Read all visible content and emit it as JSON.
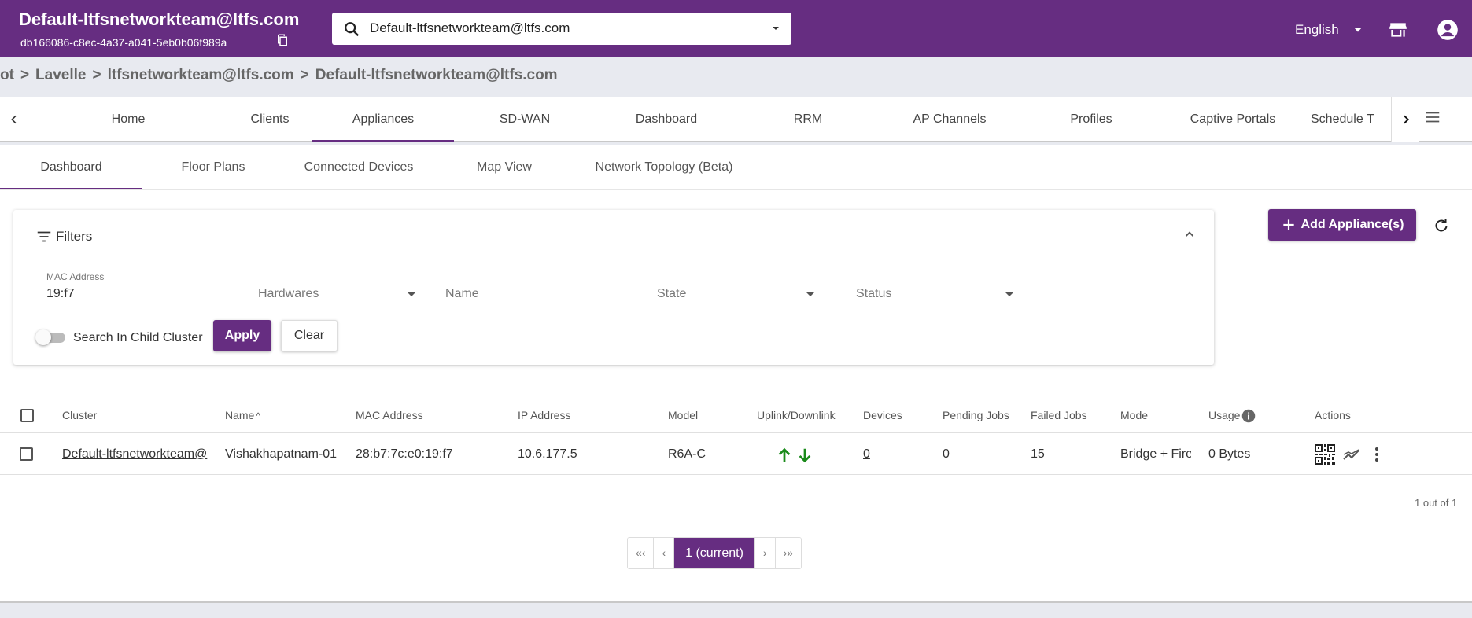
{
  "header": {
    "org_title": "Default-ltfsnetworkteam@ltfs.com",
    "org_id": "db166086-c8ec-4a37-a041-5eb0b06f989a",
    "search_value": "Default-ltfsnetworkteam@ltfs.com",
    "language": "English"
  },
  "breadcrumb": [
    "ot",
    "Lavelle",
    "ltfsnetworkteam@ltfs.com",
    "Default-ltfsnetworkteam@ltfs.com"
  ],
  "nav": {
    "tabs": [
      "Home",
      "Clients",
      "Appliances",
      "SD-WAN",
      "Dashboard",
      "RRM",
      "AP Channels",
      "Profiles",
      "Captive Portals",
      "Schedule T"
    ],
    "active": "Appliances"
  },
  "subtabs": [
    "Dashboard",
    "Floor Plans",
    "Connected Devices",
    "Map View",
    "Network Topology (Beta)"
  ],
  "filters": {
    "title": "Filters",
    "mac_label": "MAC Address",
    "mac_value": "19:f7",
    "hardwares_placeholder": "Hardwares",
    "name_placeholder": "Name",
    "state_placeholder": "State",
    "status_placeholder": "Status",
    "child_cluster_label": "Search In Child Cluster",
    "child_cluster_on": false,
    "apply_label": "Apply",
    "clear_label": "Clear"
  },
  "actions": {
    "add_label": "Add Appliance(s)"
  },
  "table": {
    "columns": [
      "Cluster",
      "Name",
      "MAC Address",
      "IP Address",
      "Model",
      "Uplink/Downlink",
      "Devices",
      "Pending Jobs",
      "Failed Jobs",
      "Mode",
      "Usage",
      "Actions"
    ],
    "sort_indicator": "^",
    "rows": [
      {
        "cluster": "Default-ltfsnetworkteam@",
        "name": "Vishakhapatnam-01",
        "mac": "28:b7:7c:e0:19:f7",
        "ip": "10.6.177.5",
        "model": "R6A-C",
        "devices": "0",
        "pending_jobs": "0",
        "failed_jobs": "15",
        "mode": "Bridge + Firew",
        "usage": "0 Bytes"
      }
    ]
  },
  "pagination": {
    "count_text": "1 out of 1",
    "first": "«‹",
    "prev": "‹",
    "current": "1 (current)",
    "next": "›",
    "last": "›»"
  },
  "colors": {
    "brand": "#662d81",
    "uplink": "#1a8a1a"
  }
}
